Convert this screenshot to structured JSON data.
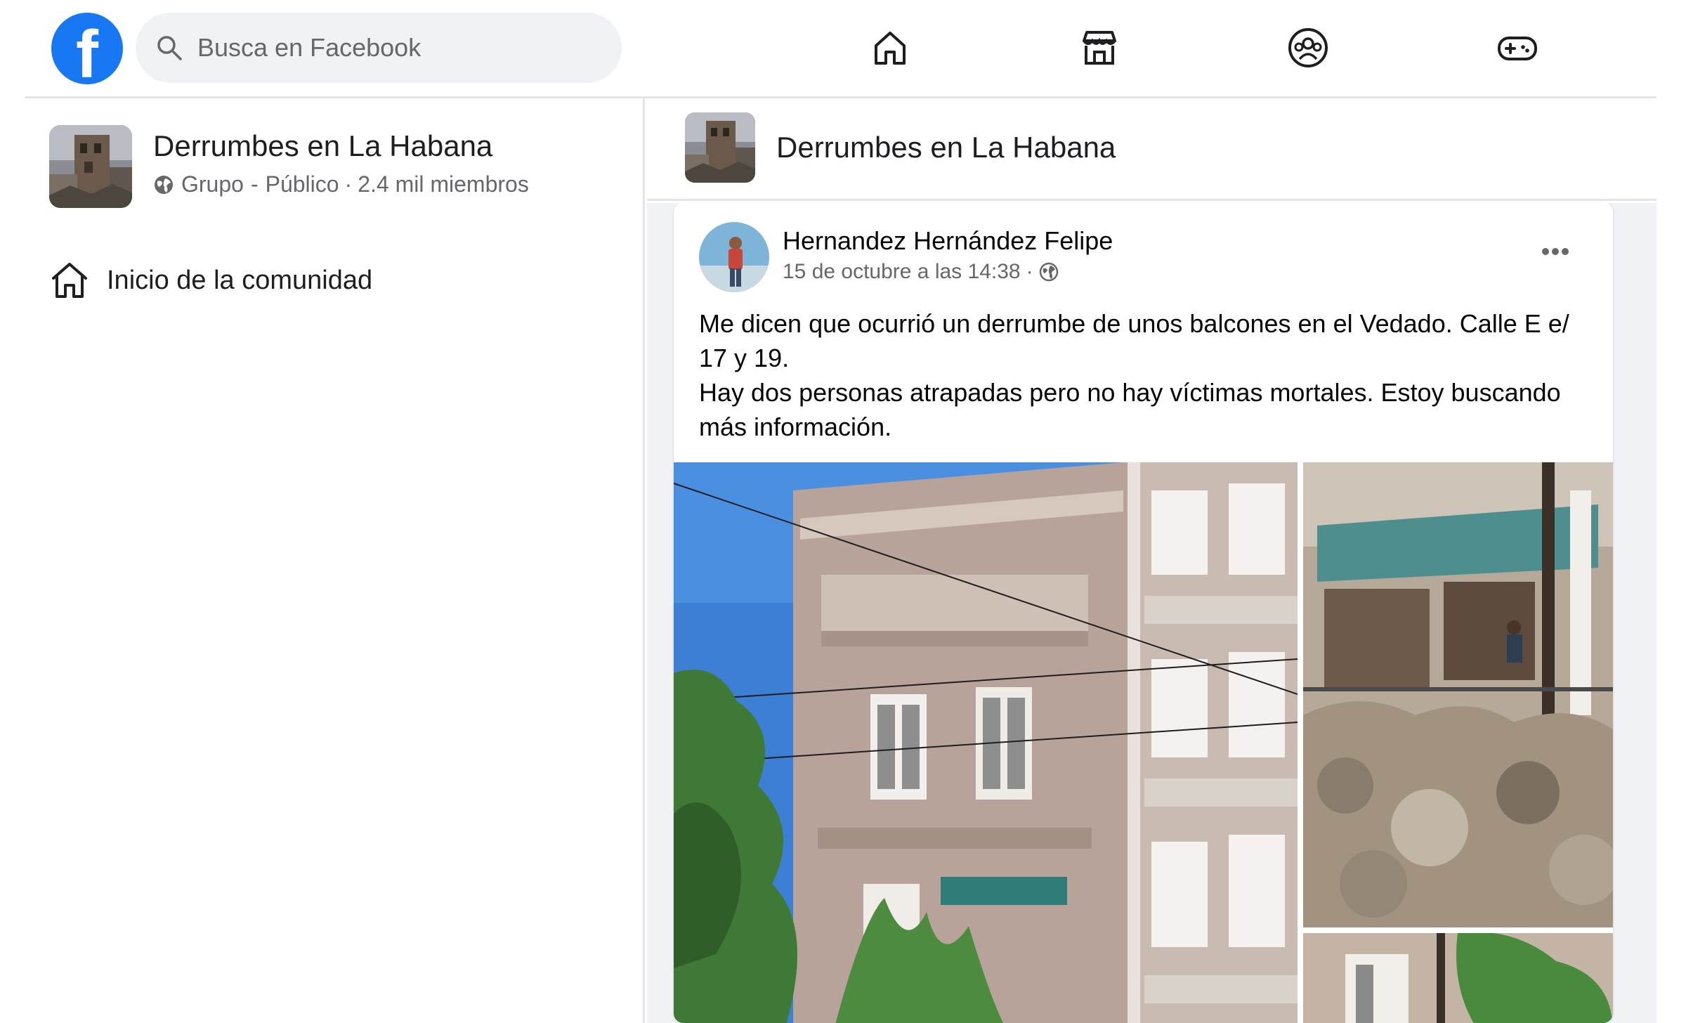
{
  "header": {
    "logo_icon": "facebook-logo-icon",
    "logo_letter": "f",
    "search_placeholder": "Busca en Facebook",
    "nav_icons": [
      "home-icon",
      "marketplace-icon",
      "groups-icon",
      "gaming-icon"
    ],
    "brand_color": "#1877f2"
  },
  "sidebar": {
    "group_name": "Derrumbes en La Habana",
    "group_type": "Grupo",
    "separator": "·",
    "privacy": "Público",
    "members": "2.4 mil miembros",
    "community_home_label": "Inicio de la comunidad"
  },
  "main": {
    "group_name": "Derrumbes en La Habana",
    "post": {
      "author": "Hernandez Hernández Felipe",
      "timestamp": "15 de octubre a las 14:38",
      "dot": "·",
      "privacy_icon": "globe-icon",
      "more_icon": "more-options-icon",
      "text_line_1": "Me dicen que ocurrió un derrumbe de unos balcones en el Vedado. Calle E e/ 17 y 19.",
      "text_line_2": "Hay dos personas atrapadas pero no hay víctimas mortales. Estoy buscando más información.",
      "photos": [
        "building-facade-photo",
        "collapse-debris-photo",
        "street-photo"
      ]
    }
  }
}
